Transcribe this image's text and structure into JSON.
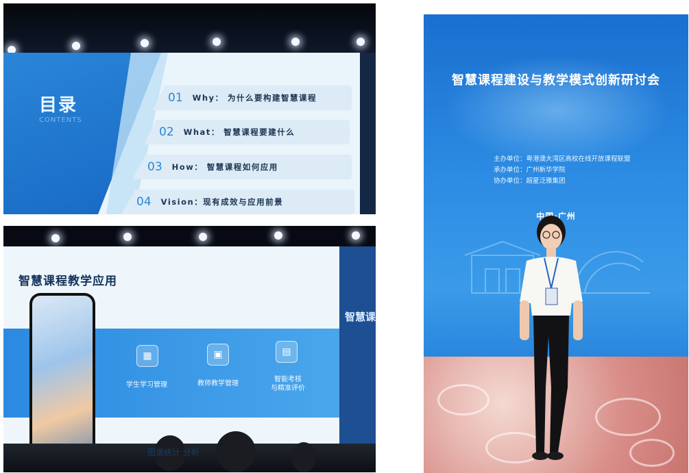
{
  "photo1": {
    "title": "目录",
    "subtitle": "CONTENTS",
    "items": [
      {
        "num": "01",
        "text": "Why： 为什么要构建智慧课程"
      },
      {
        "num": "02",
        "text": "What： 智慧课程要建什么"
      },
      {
        "num": "03",
        "text": "How： 智慧课程如何应用"
      },
      {
        "num": "04",
        "text": "Vision：现有成效与应用前景"
      }
    ]
  },
  "photo2": {
    "title": "智慧课程教学应用",
    "side_text": "智慧课",
    "features": [
      {
        "icon": "student-management-icon",
        "label_line1": "学生学习管理",
        "label_line2": ""
      },
      {
        "icon": "teacher-management-icon",
        "label_line1": "教师教学管理",
        "label_line2": ""
      },
      {
        "icon": "assessment-icon",
        "label_line1": "智能考核",
        "label_line2": "与精准评价"
      }
    ],
    "footer": "图谱统计 分析"
  },
  "photo3": {
    "title": "智慧课程建设与教学模式创新研讨会",
    "organizers": [
      "主办单位：粤港澳大湾区高校在线开放课程联盟",
      "承办单位：广州新华学院",
      "协办单位：超星泛雅集团"
    ],
    "city": "中国·广州"
  },
  "colors": {
    "slide_blue": "#2b8ae0",
    "banner_blue": "#1a75d2",
    "carpet": "#d98e89"
  }
}
